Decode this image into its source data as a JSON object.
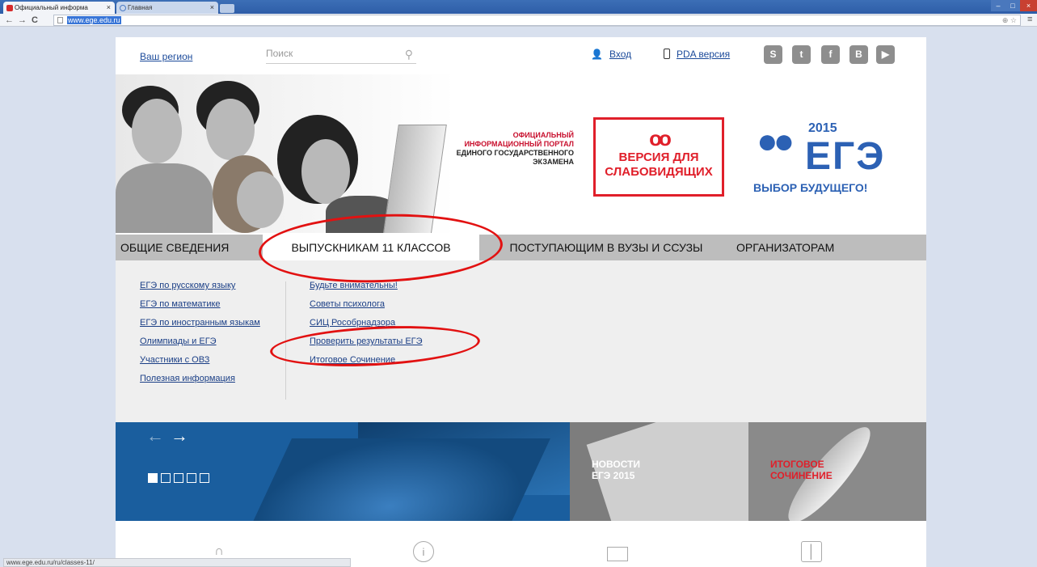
{
  "browser": {
    "tabs": [
      {
        "label": "Официальный информа",
        "active": true
      },
      {
        "label": "Главная",
        "active": false
      }
    ],
    "close_glyph": "×",
    "back_glyph": "←",
    "forward_glyph": "→",
    "reload_glyph": "C",
    "url": "www.ege.edu.ru",
    "omni_icons": "⊕ ☆",
    "menu_glyph": "≡",
    "status_url": "www.ege.edu.ru/ru/classes-11/"
  },
  "header": {
    "region_label": "Ваш регион",
    "search_placeholder": "Поиск",
    "login_label": "Вход",
    "pda_label": "PDA версия",
    "social": [
      "skype-icon",
      "twitter-icon",
      "facebook-icon",
      "vkontakte-icon",
      "youtube-icon"
    ],
    "social_glyphs": [
      "S",
      "t",
      "f",
      "B",
      "▶"
    ]
  },
  "hero": {
    "portal_line1": "ОФИЦИАЛЬНЫЙ",
    "portal_line2": "ИНФОРМАЦИОННЫЙ ПОРТАЛ",
    "portal_line3": "ЕДИНОГО ГОСУДАРСТВЕННОГО",
    "portal_line4": "ЭКЗАМЕНА",
    "vision_line1": "ВЕРСИЯ ДЛЯ",
    "vision_line2": "СЛАБОВИДЯЩИХ",
    "logo_year": "2015",
    "logo_text": "ЕГЭ",
    "logo_slogan": "ВЫБОР БУДУЩЕГО!"
  },
  "main_menu": [
    "ОБЩИЕ СВЕДЕНИЯ",
    "ВЫПУСКНИКАМ 11 КЛАССОВ",
    "ПОСТУПАЮЩИМ В ВУЗЫ И ССУЗЫ",
    "ОРГАНИЗАТОРАМ"
  ],
  "submenu": {
    "left": [
      "ЕГЭ по русскому языку",
      "ЕГЭ по математике",
      "ЕГЭ по иностранным языкам",
      "Олимпиады и ЕГЭ",
      "Участники с ОВЗ",
      "Полезная информация"
    ],
    "right": [
      "Будьте внимательны!",
      "Советы психолога",
      "СИЦ Рособрнадзора",
      "Проверить результаты ЕГЭ",
      "Итоговое Сочинение"
    ]
  },
  "banners": {
    "news_line1": "НОВОСТИ",
    "news_line2": "ЕГЭ 2015",
    "essay_line1": "ИТОГОВОЕ",
    "essay_line2": "СОЧИНЕНИЕ",
    "slider_dots_count": 5,
    "slider_active_index": 0
  },
  "colors": {
    "accent_red": "#e01f2a",
    "brand_blue": "#2c61b4",
    "annotation_red": "#e21111"
  }
}
